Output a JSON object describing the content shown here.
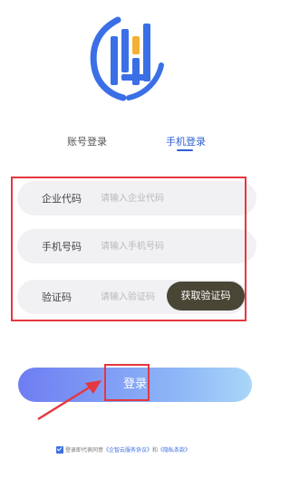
{
  "tabs": {
    "account_login": "账号登录",
    "phone_login": "手机登录",
    "active": "phone_login"
  },
  "form": {
    "company_code_label": "企业代码",
    "company_code_placeholder": "请输入企业代码",
    "phone_label": "手机号码",
    "phone_placeholder": "请输入手机号码",
    "code_label": "验证码",
    "code_placeholder": "请输入验证码",
    "get_code_button": "获取验证码"
  },
  "login_button": "登录",
  "agreement": {
    "checked": true,
    "prefix": "登录即代表同意",
    "service_link": "《企智云服务协议》",
    "conjunction": "和",
    "privacy_link": "《隐私条款》"
  },
  "colors": {
    "accent": "#2f5fd7",
    "highlight": "#e5373f",
    "code_button": "#4a4636",
    "logo_gold": "#f2b134"
  },
  "icons": {
    "logo": "building-logo-icon",
    "annotation": "red-arrow-icon",
    "checkbox": "checkbox-checked-icon"
  }
}
